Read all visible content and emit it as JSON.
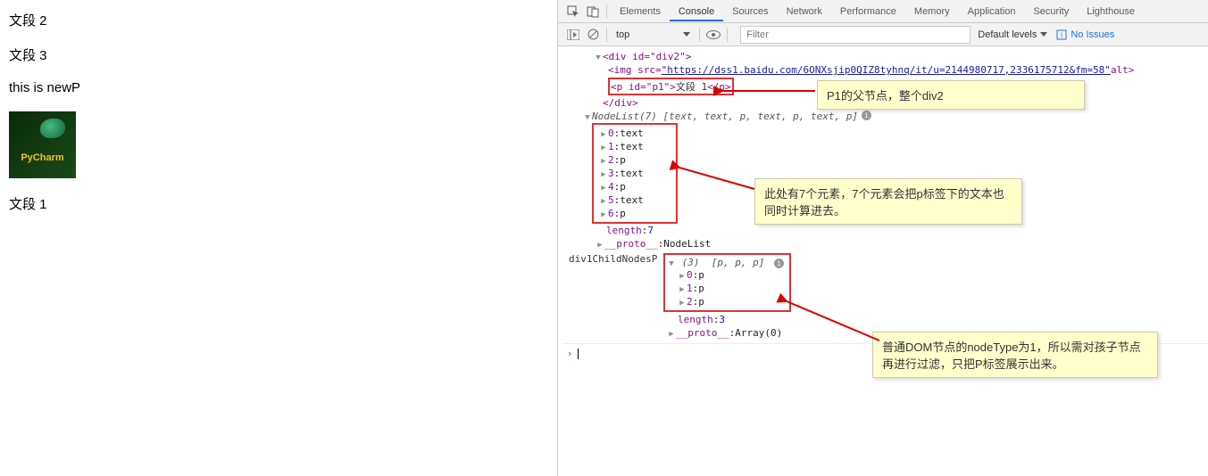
{
  "page": {
    "p1": "文段 2",
    "p2": "文段 3",
    "p3": "this is newP",
    "pycharm_label": "PyCharm",
    "p4": "文段 1"
  },
  "tabs": {
    "elements": "Elements",
    "console": "Console",
    "sources": "Sources",
    "network": "Network",
    "performance": "Performance",
    "memory": "Memory",
    "application": "Application",
    "security": "Security",
    "lighthouse": "Lighthouse"
  },
  "toolbar": {
    "context": "top",
    "filter_placeholder": "Filter",
    "levels": "Default levels",
    "issues": "No Issues"
  },
  "dom": {
    "div_open": "<div id=\"div2\">",
    "img_pre": "<img src=",
    "img_url": "\"https://dss1.baidu.com/6ONXsjip0QIZ8tyhnq/it/u=2144980717,2336175712&fm=58\"",
    "img_post": " alt>",
    "p_open": "<p id=\"p1\">",
    "p_text": "文段 1",
    "p_close": "</p>",
    "div_close": "</div>"
  },
  "nodelist": {
    "header": "NodeList(7)",
    "preview": "[text, text, p, text, p, text, p]",
    "items": [
      {
        "k": "0",
        "v": "text"
      },
      {
        "k": "1",
        "v": "text"
      },
      {
        "k": "2",
        "v": "p"
      },
      {
        "k": "3",
        "v": "text"
      },
      {
        "k": "4",
        "v": "p"
      },
      {
        "k": "5",
        "v": "text"
      },
      {
        "k": "6",
        "v": "p"
      }
    ],
    "length_k": "length",
    "length_v": "7",
    "proto_k": "__proto__",
    "proto_v": "NodeList"
  },
  "childnodes": {
    "label": "div1ChildNodesP",
    "header": "(3)",
    "preview": "[p, p, p]",
    "items": [
      {
        "k": "0",
        "v": "p"
      },
      {
        "k": "1",
        "v": "p"
      },
      {
        "k": "2",
        "v": "p"
      }
    ],
    "length_k": "length",
    "length_v": "3",
    "proto_k": "__proto__",
    "proto_v": "Array(0)"
  },
  "notes": {
    "n1": "P1的父节点，整个div2",
    "n2": "此处有7个元素，7个元素会把p标签下的文本也同时计算进去。",
    "n3": "普通DOM节点的nodeType为1，所以需对孩子节点再进行过滤，只把P标签展示出来。"
  }
}
